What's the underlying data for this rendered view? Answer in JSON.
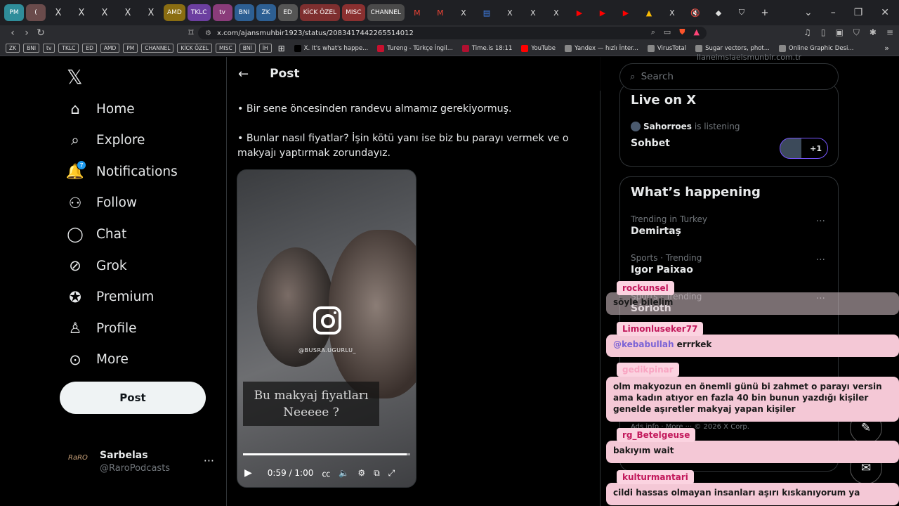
{
  "browser": {
    "tabs": [
      {
        "label": "PM",
        "bg": "#2f8d9a"
      },
      {
        "label": "(",
        "bg": "#6a4b4b"
      },
      {
        "label": "X",
        "bg": "transparent"
      },
      {
        "label": "X",
        "bg": "transparent"
      },
      {
        "label": "X",
        "bg": "transparent"
      },
      {
        "label": "X",
        "bg": "transparent"
      },
      {
        "label": "X",
        "bg": "transparent"
      },
      {
        "label": "AMD",
        "bg": "#8a6d12"
      },
      {
        "label": "TKLC",
        "bg": "#6c3fa0"
      },
      {
        "label": "tv",
        "bg": "#8a3c7a"
      },
      {
        "label": "BNI",
        "bg": "#2d5f93"
      },
      {
        "label": "ZK",
        "bg": "#2d5f93"
      },
      {
        "label": "ED",
        "bg": "#555"
      },
      {
        "label": "KİCK ÖZEL",
        "bg": "#7e2f2f"
      },
      {
        "label": "MISC",
        "bg": "#8a3030"
      },
      {
        "label": "CHANNEL",
        "bg": "#4a4a4a"
      }
    ],
    "extra_tab_icons": [
      "gmail-icon",
      "gmail-icon",
      "x-icon",
      "docs-icon",
      "x-icon",
      "x-icon",
      "x-icon",
      "youtube-icon",
      "youtube-icon",
      "youtube-icon",
      "drive-icon",
      "x-icon",
      "mute-icon",
      "app-icon",
      "shield-icon"
    ],
    "url": "x.com/ajansmuhbir1923/status/2083417442265514012",
    "bookmark_chips": [
      "ZK",
      "BNI",
      "tv",
      "TKLC",
      "ED",
      "AMD",
      "PM",
      "CHANNEL",
      "KİCK ÖZEL",
      "MISC",
      "BNİ",
      "İH"
    ],
    "bookmark_links": [
      {
        "label": "X. It's what's happe...",
        "color": "#000"
      },
      {
        "label": "Tureng - Türkçe İngil...",
        "color": "#c8102e"
      },
      {
        "label": "Time.is 18:11",
        "color": "#b01030"
      },
      {
        "label": "YouTube",
        "color": "#ff0000"
      },
      {
        "label": "Yandex — hızlı İnter...",
        "color": "#888"
      },
      {
        "label": "VirusTotal",
        "color": "#888"
      },
      {
        "label": "Sugar vectors, phot...",
        "color": "#888"
      },
      {
        "label": "Online Graphic Desi...",
        "color": "#888"
      }
    ]
  },
  "nav": {
    "items": [
      {
        "label": "Home",
        "icon": "home-icon"
      },
      {
        "label": "Explore",
        "icon": "search-icon"
      },
      {
        "label": "Notifications",
        "icon": "bell-icon"
      },
      {
        "label": "Follow",
        "icon": "follow-icon"
      },
      {
        "label": "Chat",
        "icon": "chat-icon"
      },
      {
        "label": "Grok",
        "icon": "grok-icon"
      },
      {
        "label": "Premium",
        "icon": "premium-icon"
      },
      {
        "label": "Profile",
        "icon": "profile-icon"
      },
      {
        "label": "More",
        "icon": "more-icon"
      }
    ],
    "notifications_count": "7",
    "post_label": "Post",
    "account": {
      "name": "Sarbelas",
      "handle": "@RaroPodcasts",
      "avatar_text": "RaRO"
    }
  },
  "post": {
    "header": "Post",
    "paragraphs": [
      "• Bir sene öncesinden randevu almamız gerekiyormuş.",
      "• Bunlar nasıl fiyatlar? İşin kötü yanı ise biz bu parayı vermek ve o makyajı yaptırmak zorundayız."
    ],
    "video": {
      "ig_handle": "@BUSRA.UGURLU_",
      "caption_line1": "Bu makyaj fiyatları",
      "caption_line2": "Neeeee ?",
      "time": "0:59 / 1:00",
      "progress": 0.98
    }
  },
  "sidebar": {
    "search_placeholder": "Search",
    "live": {
      "title": "Live on X",
      "user": "Sahorroes",
      "status": "is listening",
      "room": "Sohbet",
      "extra": "+1"
    },
    "happening": {
      "title": "What’s happening",
      "trends": [
        {
          "meta": "Trending in Turkey",
          "name": "Demirtaş"
        },
        {
          "meta": "Sports · Trending",
          "name": "Igor Paixao"
        },
        {
          "meta": "Sports · Trending",
          "name": "Sörloth"
        }
      ]
    },
    "footer": "Ads info · More ··· © 2026 X Corp.",
    "top_cutoff": "llaneimslaeismunbir.com.tr"
  },
  "chat_overlay": [
    {
      "user": "rockunsel",
      "text": "söyle bilelim",
      "mention": "",
      "user_color": "#c2185b"
    },
    {
      "user": "Limonluseker77",
      "text": "errrkek",
      "mention": "@kebabullah",
      "user_color": "#c2185b"
    },
    {
      "user": "gedikpinar",
      "text": "olm makyozun en önemli günü bi zahmet o parayı versin ama kadın atıyor en fazla 40 bin bunun yazdığı kişiler genelde aşıretler makyaj yapan kişiler",
      "mention": "",
      "user_color": "#f8a5c2"
    },
    {
      "user": "rg_Betelgeuse",
      "text": "bakıyım wait",
      "mention": "",
      "user_color": "#c2185b"
    },
    {
      "user": "kulturmantari",
      "text": "cildi hassas olmayan insanları aşırı kıskanıyorum ya",
      "mention": "",
      "user_color": "#c2185b"
    }
  ]
}
